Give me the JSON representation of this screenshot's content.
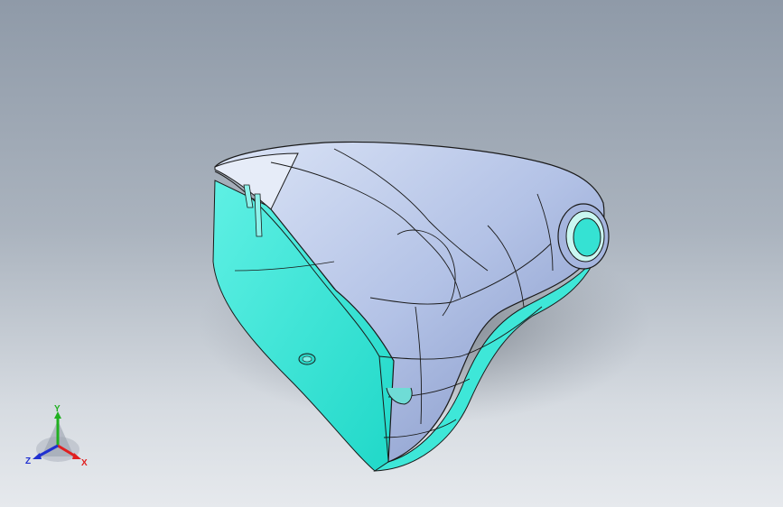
{
  "view": {
    "background_top": "#8f9aa8",
    "background_bottom": "#e6e9ed"
  },
  "model": {
    "outer_color": "#b9c8ea",
    "inner_color": "#33e5d6",
    "edge_color": "#1a1a1a"
  },
  "triad": {
    "x_label": "X",
    "y_label": "Y",
    "z_label": "Z",
    "x_color": "#e02020",
    "y_color": "#20b020",
    "z_color": "#2030d0"
  }
}
